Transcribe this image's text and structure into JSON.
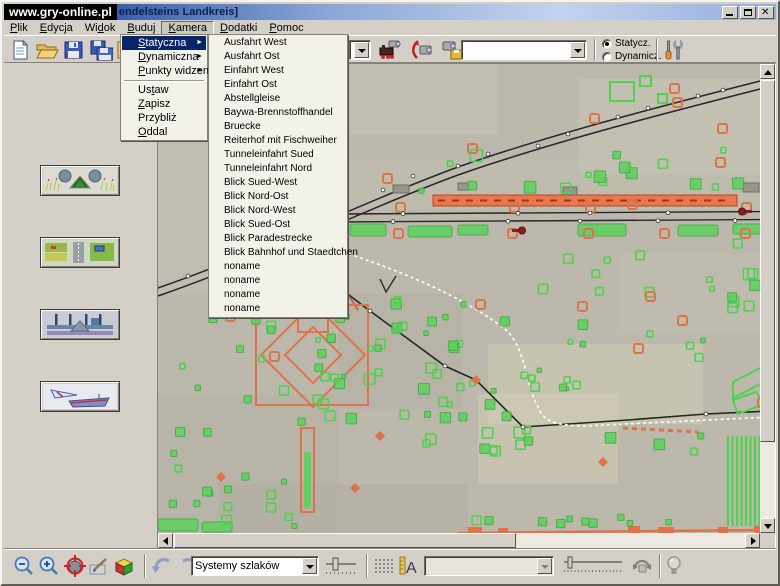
{
  "titlebar": {
    "badge": "www.gry-online.pl",
    "title": "endelsteins Landkreis]"
  },
  "menu_bar": {
    "items": [
      {
        "pre": "",
        "u": "P",
        "post": "lik"
      },
      {
        "pre": "",
        "u": "E",
        "post": "dycja"
      },
      {
        "pre": "Wi",
        "u": "d",
        "post": "ok"
      },
      {
        "pre": "",
        "u": "B",
        "post": "uduj"
      },
      {
        "pre": "",
        "u": "K",
        "post": "amera",
        "active": true
      },
      {
        "pre": "",
        "u": "D",
        "post": "odatki"
      },
      {
        "pre": "",
        "u": "P",
        "post": "omoc"
      }
    ]
  },
  "camera_menu": {
    "items": [
      {
        "pre": "",
        "u": "S",
        "post": "tatyczna",
        "submenu": true,
        "highlight": true
      },
      {
        "pre": "",
        "u": "D",
        "post": "ynamiczna",
        "submenu": true
      },
      {
        "pre": "",
        "u": "P",
        "post": "unkty widzenia",
        "submenu": true
      },
      {
        "separator": true
      },
      {
        "pre": "Us",
        "u": "t",
        "post": "aw"
      },
      {
        "pre": "",
        "u": "Z",
        "post": "apisz"
      },
      {
        "pre": "Przybliż",
        "u": "",
        "post": ""
      },
      {
        "pre": "",
        "u": "O",
        "post": "ddal"
      }
    ]
  },
  "static_camera_submenu": {
    "items": [
      "Ausfahrt West",
      "Ausfahrt Ost",
      "Einfahrt West",
      "Einfahrt Ost",
      "Abstellgleise",
      "Baywa-Brennstoffhandel",
      "Bruecke",
      "Reiterhof mit Fischweiher",
      "Tunneleinfahrt Sued",
      "Tunneleinfahrt Nord",
      "Blick Sued-West",
      "Blick Nord-Ost",
      "Blick Nord-West",
      "Blick Sued-Ost",
      "Blick Paradestrecke",
      "Blick Bahnhof und Staedtchen",
      "noname",
      "noname",
      "noname",
      "noname"
    ]
  },
  "toolbar": {
    "camera_select_value": "",
    "mode_radio": {
      "static_label": "Statycz.",
      "dynamic_label": "Dynamicz.",
      "selected": "static"
    }
  },
  "bottom_toolbar": {
    "track_system_combo_value": "Systemy szlaków",
    "object_combo_value": ""
  },
  "icons": {
    "submenu_arrow": "►"
  },
  "map": {
    "colors": {
      "terrain": "#bcb9ac",
      "tree_green": "#4fd24f",
      "tree_fill": "#63cf63",
      "object_orange": "#e0724a",
      "track_dark": "#26262e",
      "road_white": "#ffffff",
      "platform_fill": "#e8784e",
      "platform_border": "#b8441f",
      "signal_red": "#8b1c1c"
    }
  }
}
